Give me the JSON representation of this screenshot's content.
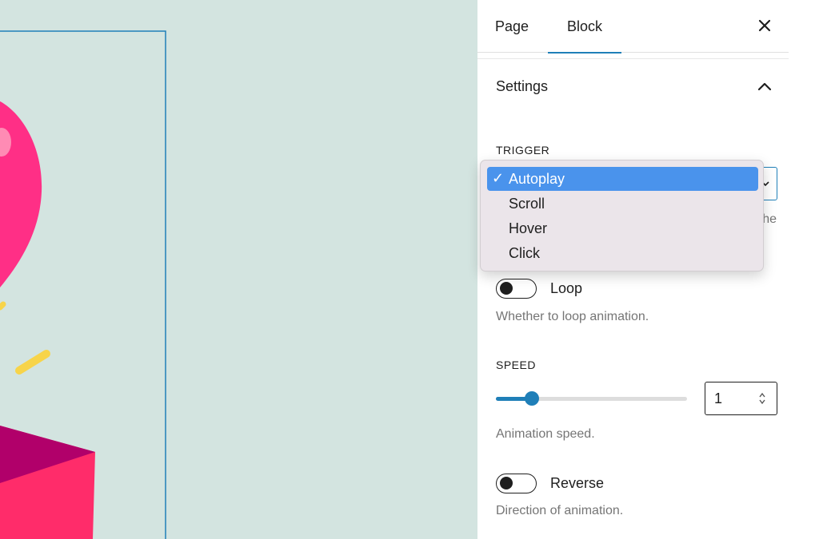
{
  "sidebar": {
    "tabs": [
      {
        "label": "Page",
        "active": false
      },
      {
        "label": "Block",
        "active": true
      }
    ],
    "close_icon": "close-icon",
    "panel": {
      "title": "Settings",
      "expanded": true
    },
    "trigger": {
      "label": "TRIGGER",
      "selected": "Autoplay",
      "help_visible_fragment": "he"
    },
    "loop": {
      "label": "Loop",
      "enabled": false,
      "help": "Whether to loop animation."
    },
    "speed": {
      "label": "SPEED",
      "value": "1",
      "slider_fraction": 0.19,
      "help": "Animation speed."
    },
    "reverse": {
      "label": "Reverse",
      "enabled": false,
      "help": "Direction of animation."
    }
  },
  "dropdown": {
    "options": [
      {
        "label": "Autoplay",
        "checkmark": "✓",
        "selected": true
      },
      {
        "label": "Scroll",
        "selected": false
      },
      {
        "label": "Hover",
        "selected": false
      },
      {
        "label": "Click",
        "selected": false
      }
    ]
  },
  "colors": {
    "accent": "#1f7fb8",
    "canvas_bg": "#d3e4e0",
    "dropdown_highlight": "#4a93ec"
  }
}
